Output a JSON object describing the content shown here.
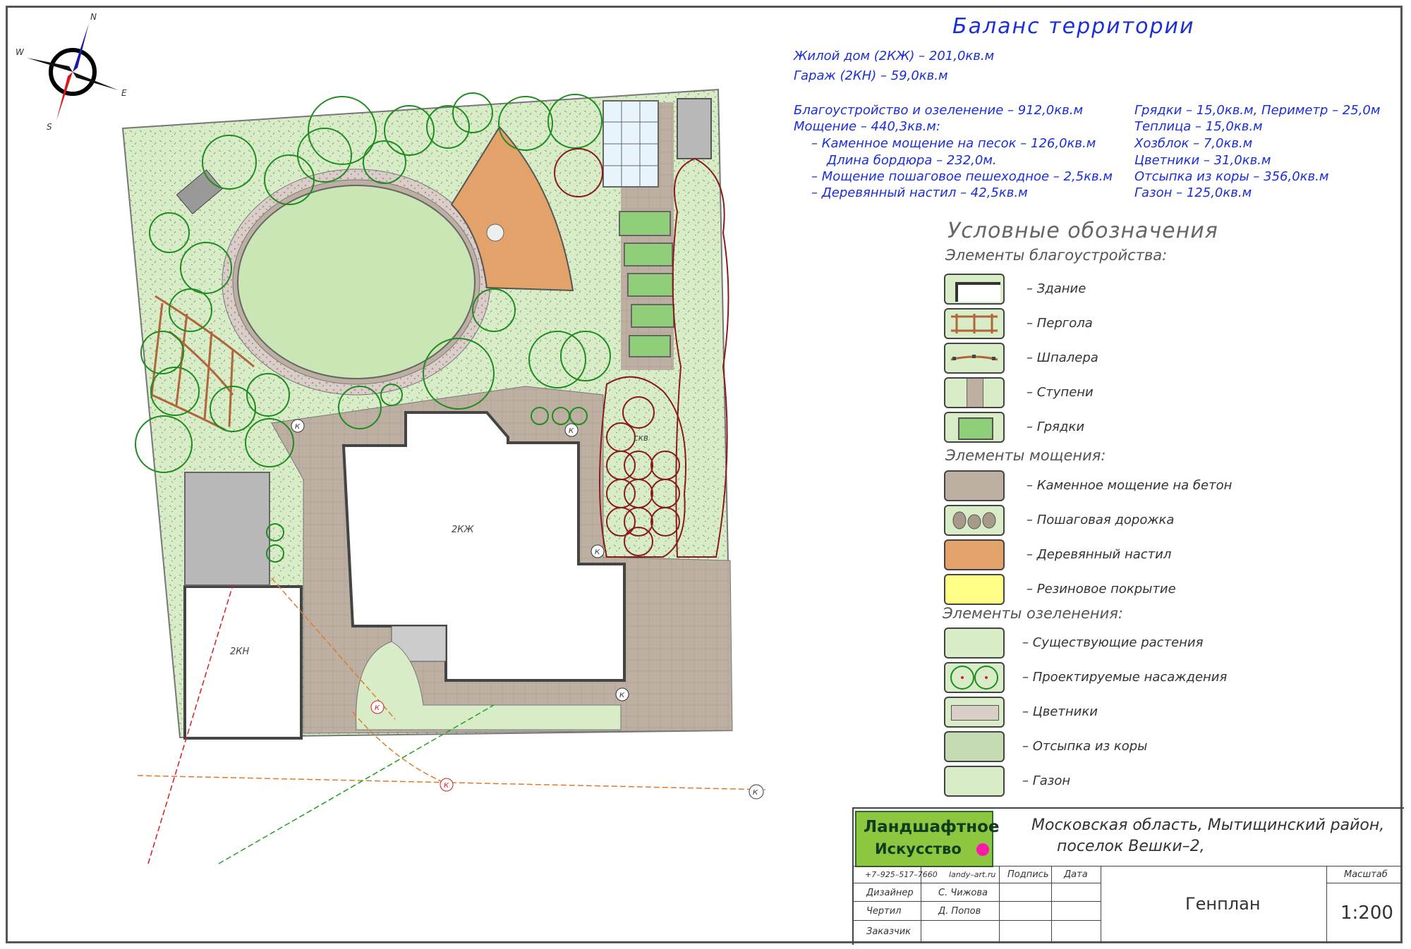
{
  "compass": {
    "n": "N",
    "s": "S",
    "e": "E",
    "w": "W"
  },
  "plan_labels": {
    "house": "2КЖ",
    "garage": "2КН",
    "skv": "скв",
    "k": "К"
  },
  "balance": {
    "title": "Баланс территории",
    "house": "Жилой дом (2КЖ) – 201,0кв.м",
    "garage": "Гараж (2КН) – 59,0кв.м",
    "left": [
      "Благоустройство и озеленение – 912,0кв.м",
      "Мощение – 440,3кв.м:",
      "– Каменное мощение на песок – 126,0кв.м",
      "Длина бордюра – 232,0м.",
      "– Мощение пошаговое пешеходное – 2,5кв.м",
      "– Деревянный настил – 42,5кв.м"
    ],
    "right": [
      "Грядки – 15,0кв.м, Периметр – 25,0м",
      "Теплица – 15,0кв.м",
      "Хозблок – 7,0кв.м",
      "Цветники – 31,0кв.м",
      "Отсыпка из коры – 356,0кв.м",
      "Газон – 125,0кв.м"
    ]
  },
  "legend": {
    "title": "Условные обозначения",
    "sections": [
      {
        "title": "Элементы благоустройства:",
        "items": [
          {
            "label": "– Здание",
            "icon": "building-swatch"
          },
          {
            "label": "– Пергола",
            "icon": "pergola-swatch"
          },
          {
            "label": "– Шпалера",
            "icon": "trellis-swatch"
          },
          {
            "label": "– Ступени",
            "icon": "steps-swatch"
          },
          {
            "label": "– Грядки",
            "icon": "garden-bed-swatch"
          }
        ]
      },
      {
        "title": "Элементы мощения:",
        "items": [
          {
            "label": "– Каменное мощение на бетон",
            "icon": "stone-paving-swatch"
          },
          {
            "label": "– Пошаговая дорожка",
            "icon": "stepping-path-swatch"
          },
          {
            "label": "– Деревянный настил",
            "icon": "wood-deck-swatch"
          },
          {
            "label": "– Резиновое покрытие",
            "icon": "rubber-surface-swatch"
          }
        ]
      },
      {
        "title": "Элементы озеленения:",
        "items": [
          {
            "label": "– Существующие растения",
            "icon": "existing-plants-swatch"
          },
          {
            "label": "– Проектируемые насаждения",
            "icon": "planned-plants-swatch"
          },
          {
            "label": "– Цветники",
            "icon": "flowerbed-swatch"
          },
          {
            "label": "– Отсыпка из коры",
            "icon": "bark-mulch-swatch"
          },
          {
            "label": "– Газон",
            "icon": "lawn-swatch"
          }
        ]
      }
    ]
  },
  "title_block": {
    "logo_line1": "Ландшафтное",
    "logo_line2": "Искусство",
    "address_line1": "Московская область, Мытищинский район,",
    "address_line2": "поселок Вешки–2,",
    "phone": "+7–925–517–7660",
    "site": "landy–art.ru",
    "col_sign": "Подпись",
    "col_date": "Дата",
    "designer_label": "Дизайнер",
    "designer_name": "С. Чижова",
    "drafter_label": "Чертил",
    "drafter_name": "Д. Попов",
    "client_label": "Заказчик",
    "sheet_title": "Генплан",
    "scale_label": "Масштаб",
    "scale_value": "1:200"
  },
  "colors": {
    "text_blue": "#1b2fd6",
    "lawn": "#d8ecc8",
    "paving": "#bdb0a2",
    "deck": "#e3a26a",
    "rubber": "#ffff88",
    "tree_green": "#1f8c1f",
    "tree_red": "#8b1a1a",
    "logo_bg": "#8dc63f",
    "logo_dot": "#ff19a8"
  }
}
